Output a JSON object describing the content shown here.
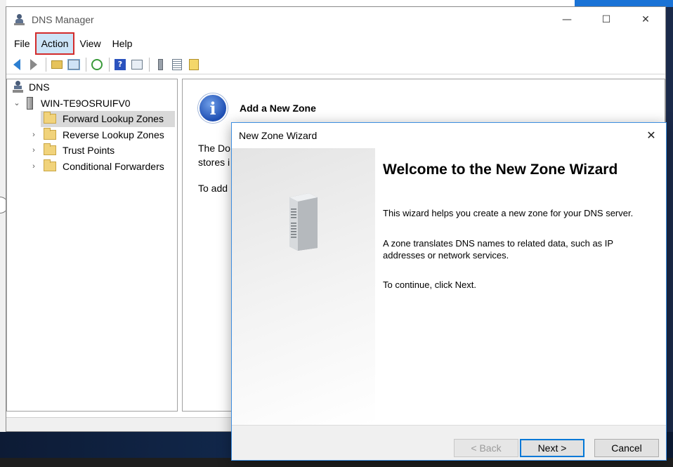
{
  "window": {
    "title": "DNS Manager",
    "controls": {
      "minimize": "—",
      "maximize": "☐",
      "close": "✕"
    }
  },
  "menu": {
    "file": "File",
    "action": "Action",
    "view": "View",
    "help": "Help"
  },
  "tree": {
    "root": "DNS",
    "server": "WIN-TE9OSRUIFV0",
    "items": [
      {
        "label": "Forward Lookup Zones",
        "selected": true,
        "expander": ""
      },
      {
        "label": "Reverse Lookup Zones",
        "selected": false,
        "expander": "›"
      },
      {
        "label": "Trust Points",
        "selected": false,
        "expander": "›"
      },
      {
        "label": "Conditional Forwarders",
        "selected": false,
        "expander": "›"
      }
    ],
    "root_expander": "",
    "server_expander": "⌄"
  },
  "right_pane": {
    "info_title": "Add a New Zone",
    "text_line1": "The Do",
    "text_line2": "stores i",
    "text_line3": "To add"
  },
  "wizard": {
    "title": "New Zone Wizard",
    "close": "✕",
    "heading": "Welcome to the New Zone Wizard",
    "para1": "This wizard helps you create a new zone for your DNS server.",
    "para2": "A zone translates DNS names to related data, such as IP addresses or network services.",
    "para3": "To continue, click Next.",
    "buttons": {
      "back": "< Back",
      "next": "Next >",
      "cancel": "Cancel"
    }
  },
  "colors": {
    "highlight_outline": "#d22b2b",
    "accent_blue": "#0078d7",
    "tree_selection": "#d9d9d9"
  }
}
